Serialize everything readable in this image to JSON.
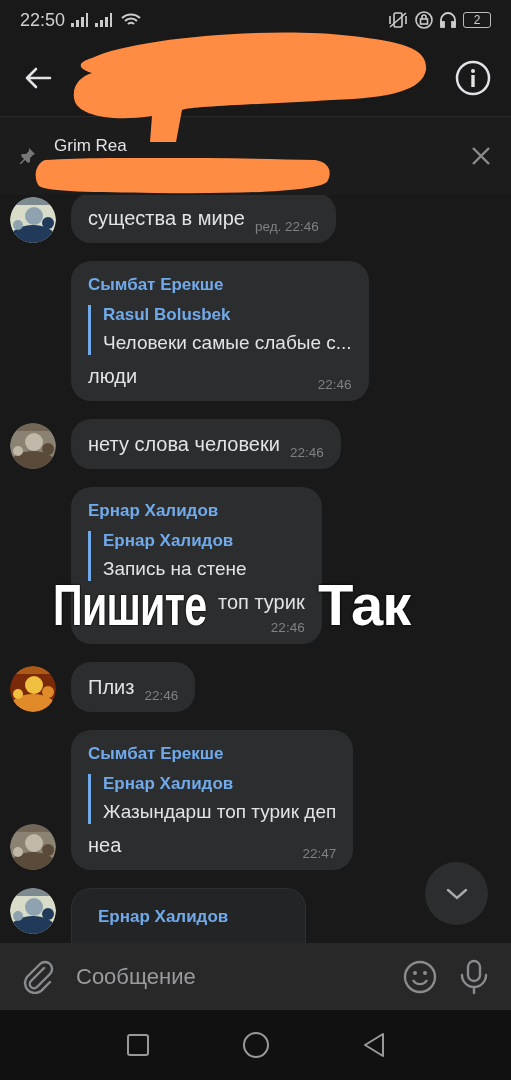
{
  "status_bar": {
    "time": "22:50",
    "battery": "2"
  },
  "pinned": {
    "text": "Grim Rea"
  },
  "messages": [
    {
      "avatar": true,
      "text": "существа в мире",
      "time": "ред. 22:46"
    },
    {
      "avatar": false,
      "sender": "Сымбат Ерекше",
      "reply": {
        "name": "Rasul Bolusbek",
        "text": "Человеки самые слабые с..."
      },
      "text": "люди",
      "time": "22:46"
    },
    {
      "avatar": true,
      "text": "нету слова человеки",
      "time": "22:46"
    },
    {
      "avatar": false,
      "sender": "Ернар Халидов",
      "reply": {
        "name": "Ернар Халидов",
        "text": "Запись на стене"
      },
      "text": "топ турик",
      "time": "22:46",
      "covered": true
    },
    {
      "avatar": true,
      "text": "Плиз",
      "time": "22:46"
    },
    {
      "avatar": true,
      "sender": "Сымбат Ерекше",
      "reply": {
        "name": "Ернар Халидов",
        "text": "Жазындарш топ турик деп"
      },
      "text": "неа",
      "time": "22:47"
    },
    {
      "avatar": true,
      "sender": "Ернар Халидов"
    }
  ],
  "caption": [
    "Пишите",
    "Так"
  ],
  "composer": {
    "placeholder": "Сообщение"
  }
}
